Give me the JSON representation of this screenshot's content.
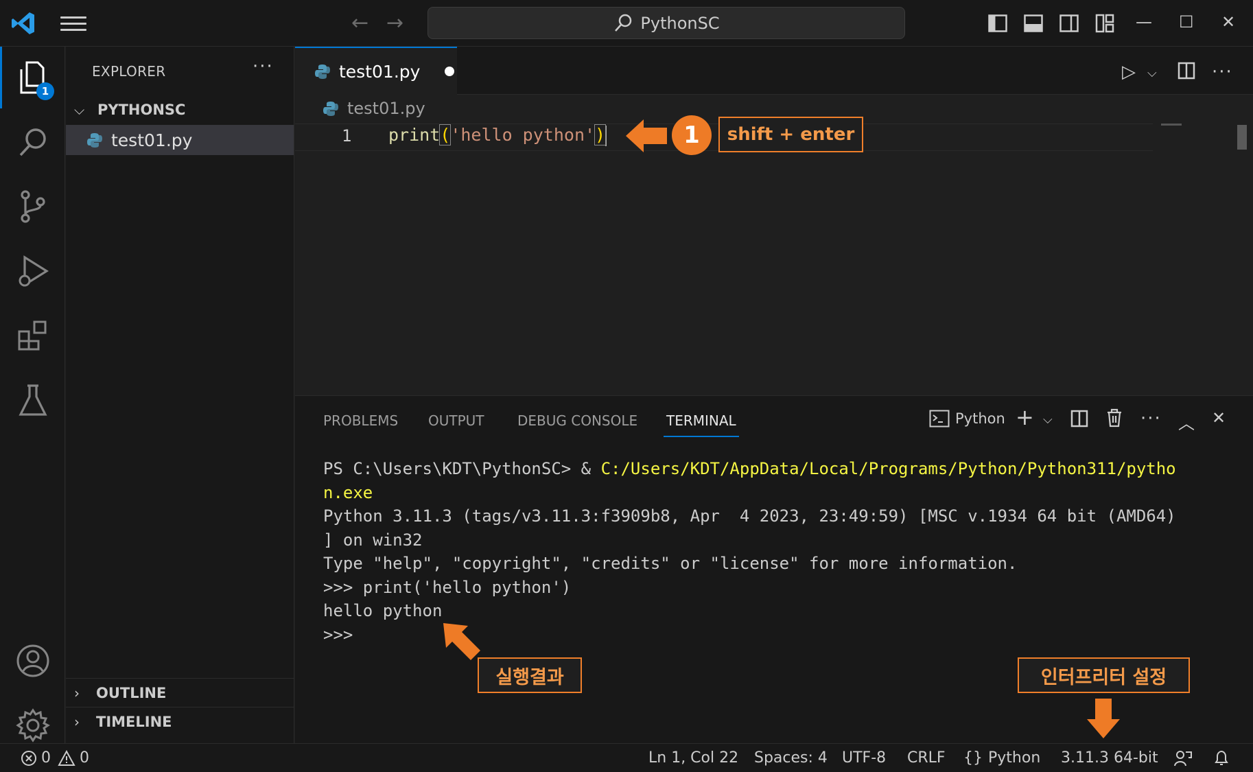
{
  "titlebar": {
    "search_text": "PythonSC"
  },
  "activity": {
    "explorer_badge": "1"
  },
  "sidebar": {
    "title": "EXPLORER",
    "more": "···",
    "folder": "PYTHONSC",
    "file": "test01.py",
    "outline": "OUTLINE",
    "timeline": "TIMELINE"
  },
  "editor": {
    "tab_label": "test01.py",
    "breadcrumb": "test01.py",
    "line_number": "1",
    "code": {
      "fn": "print",
      "open": "(",
      "str": "'hello python'",
      "close": ")"
    }
  },
  "annotations": {
    "step_number": "1",
    "step_label": "shift + enter",
    "result_label": "실행결과",
    "interpreter_label": "인터프리터 설정",
    "color": "#f07f2a"
  },
  "panel": {
    "tabs": [
      "PROBLEMS",
      "OUTPUT",
      "DEBUG CONSOLE",
      "TERMINAL"
    ],
    "active_tab": "TERMINAL",
    "terminal_profile": "Python",
    "terminal": {
      "prompt": "PS C:\\Users\\KDT\\PythonSC> & ",
      "path1": "C:/Users/KDT/AppData/Local/Programs/Python/Python311/pytho",
      "path2": "n.exe",
      "l3": "Python 3.11.3 (tags/v3.11.3:f3909b8, Apr  4 2023, 23:49:59) [MSC v.1934 64 bit (AMD64)",
      "l4": "] on win32",
      "l5": "Type \"help\", \"copyright\", \"credits\" or \"license\" for more information.",
      "l6": ">>> print('hello python')",
      "l7": "hello python",
      "l8": ">>>"
    }
  },
  "status": {
    "errors": "0",
    "warnings": "0",
    "position": "Ln 1, Col 22",
    "spaces": "Spaces: 4",
    "encoding": "UTF-8",
    "eol": "CRLF",
    "language": "Python",
    "interpreter": "3.11.3 64-bit"
  },
  "colors": {
    "accent": "#0078d4",
    "annotation": "#f07f2a",
    "terminal_path": "#f5f543"
  }
}
